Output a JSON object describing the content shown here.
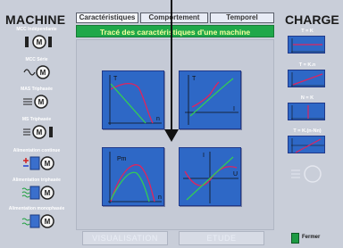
{
  "left_panel": {
    "title": "MACHINE",
    "items": [
      {
        "label": "MCC Indépendante"
      },
      {
        "label": "MCC Série"
      },
      {
        "label": "MAS Triphasée"
      },
      {
        "label": "MS Triphasée"
      },
      {
        "label": "Alimentation continue"
      },
      {
        "label": "Alimentation triphasée"
      },
      {
        "label": "Alimentation monophasée"
      }
    ],
    "motor_letter": "M"
  },
  "tabs": [
    {
      "label": "Caractéristiques"
    },
    {
      "label": "Comportement"
    },
    {
      "label": "Temporel"
    }
  ],
  "banner": "Tracé des caractéristiques d'une machine",
  "graphs": [
    {
      "y_axis": "T",
      "x_axis": "n"
    },
    {
      "y_axis": "T",
      "x_axis": "I"
    },
    {
      "y_axis": "Pm",
      "x_axis": "n"
    },
    {
      "y_axis": "I",
      "x_axis": "U"
    }
  ],
  "bottom_buttons": {
    "visualisation": "VISUALISATION",
    "etude": "ETUDE"
  },
  "right_panel": {
    "title": "CHARGE",
    "items": [
      {
        "label": "T = K"
      },
      {
        "label": "T = K.n"
      },
      {
        "label": "N = K"
      },
      {
        "label": "T = K.(n-Nn)"
      }
    ],
    "close_label": "Fermer"
  },
  "colors": {
    "accent": "#1fa84a",
    "graph_bg": "#2e68c6",
    "curve_red": "#e0245e",
    "curve_green": "#33cc55",
    "background": "#c9ced9"
  }
}
